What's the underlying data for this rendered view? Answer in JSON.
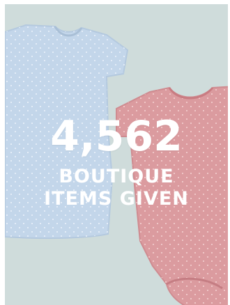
{
  "stat": {
    "number": "4,562",
    "label": "BOUTIQUE ITEMS GIVEN"
  },
  "image": {
    "subject": [
      "light-blue-onesie",
      "pink-onesie"
    ],
    "colors": {
      "background": "#cfdcdb",
      "blue_onesie": "#c3d6ea",
      "pink_onesie": "#db9b9f",
      "text": "#ffffff"
    }
  }
}
